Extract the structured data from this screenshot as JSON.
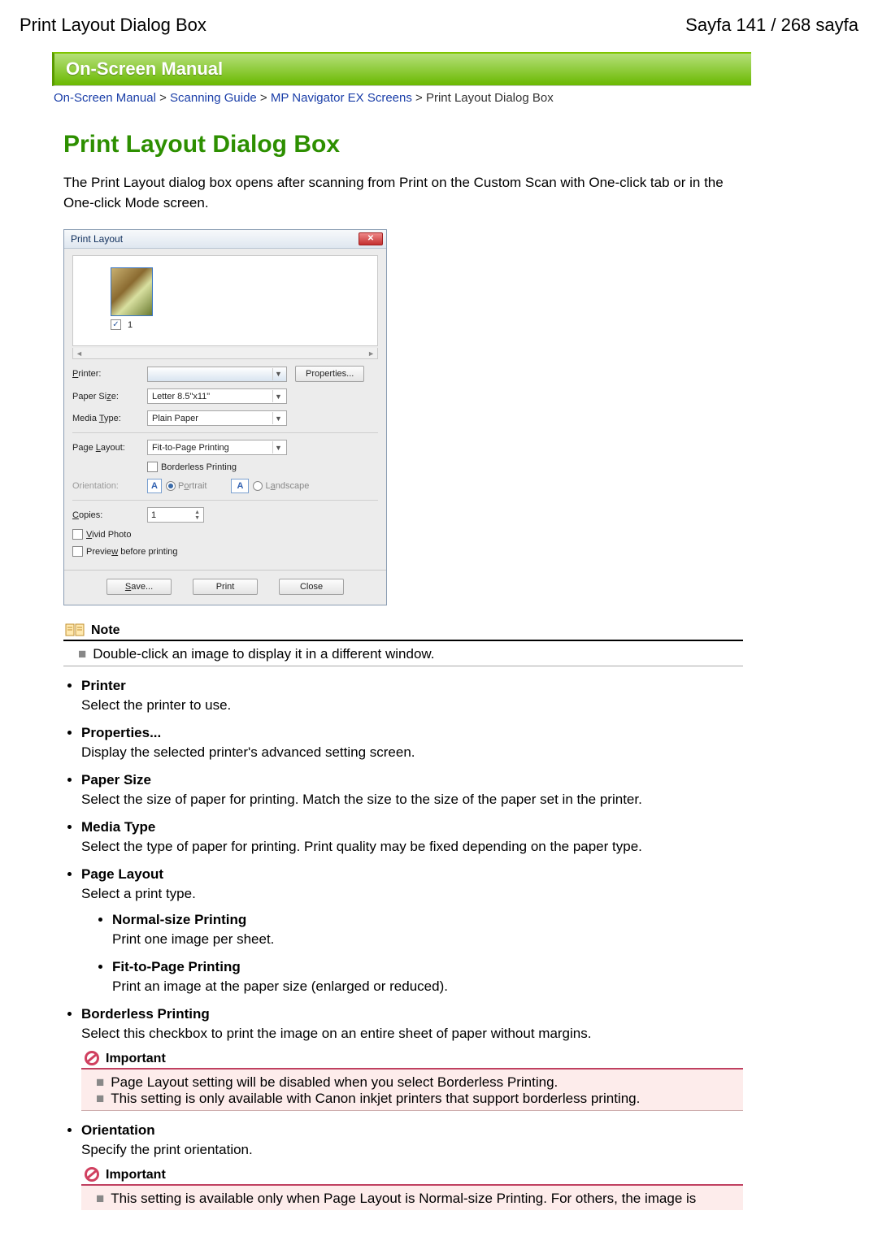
{
  "header": {
    "left": "Print Layout Dialog Box",
    "right": "Sayfa 141 / 268 sayfa"
  },
  "banner": "On-Screen Manual",
  "breadcrumb": {
    "items": [
      "On-Screen Manual",
      "Scanning Guide",
      "MP Navigator EX Screens"
    ],
    "sep": " > ",
    "current": "Print Layout Dialog Box"
  },
  "title": "Print Layout Dialog Box",
  "intro": "The Print Layout dialog box opens after scanning from Print on the Custom Scan with One-click tab or in the One-click Mode screen.",
  "dialog": {
    "title": "Print Layout",
    "thumb_index": "1",
    "labels": {
      "printer": "Printer:",
      "paper_size": "Paper Size:",
      "media_type": "Media Type:",
      "page_layout": "Page Layout:",
      "borderless": "Borderless Printing",
      "orientation": "Orientation:",
      "portrait": "Portrait",
      "landscape": "Landscape",
      "copies": "Copies:",
      "vivid": "Vivid Photo",
      "preview": "Preview before printing"
    },
    "values": {
      "printer": "",
      "paper_size": "Letter 8.5\"x11\"",
      "media_type": "Plain Paper",
      "page_layout": "Fit-to-Page Printing",
      "copies": "1"
    },
    "buttons": {
      "properties": "Properties...",
      "save": "Save...",
      "print": "Print",
      "close": "Close"
    }
  },
  "note": {
    "label": "Note",
    "items": [
      "Double-click an image to display it in a different window."
    ]
  },
  "help": [
    {
      "term": "Printer",
      "desc": "Select the printer to use."
    },
    {
      "term": "Properties...",
      "desc": "Display the selected printer's advanced setting screen."
    },
    {
      "term": "Paper Size",
      "desc": "Select the size of paper for printing. Match the size to the size of the paper set in the printer."
    },
    {
      "term": "Media Type",
      "desc": "Select the type of paper for printing. Print quality may be fixed depending on the paper type."
    },
    {
      "term": "Page Layout",
      "desc": "Select a print type.",
      "sub": [
        {
          "term": "Normal-size Printing",
          "desc": "Print one image per sheet."
        },
        {
          "term": "Fit-to-Page Printing",
          "desc": "Print an image at the paper size (enlarged or reduced)."
        }
      ]
    },
    {
      "term": "Borderless Printing",
      "desc": "Select this checkbox to print the image on an entire sheet of paper without margins.",
      "important": {
        "label": "Important",
        "items": [
          "Page Layout setting will be disabled when you select Borderless Printing.",
          "This setting is only available with Canon inkjet printers that support borderless printing."
        ]
      }
    },
    {
      "term": "Orientation",
      "desc": "Specify the print orientation.",
      "important": {
        "label": "Important",
        "items": [
          "This setting is available only when Page Layout is Normal-size Printing. For others, the image is"
        ]
      }
    }
  ]
}
